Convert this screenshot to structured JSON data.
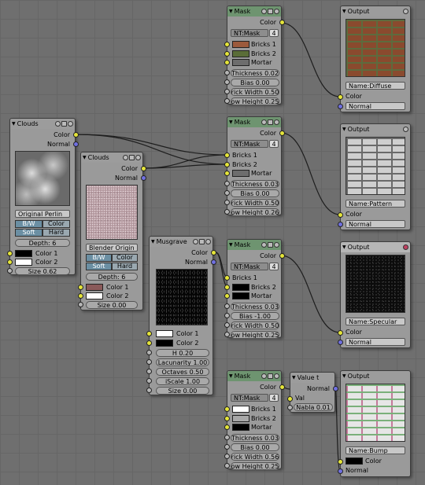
{
  "nodes": {
    "mask1": {
      "title": "Mask",
      "out_color": "Color",
      "nt": "NT:Mask",
      "num": "4",
      "bricks1": "Bricks 1",
      "bricks2": "Bricks 2",
      "mortar": "Mortar",
      "thickness": "Thickness 0.02",
      "bias": "Bias 0.00",
      "brick_width": "rick Width 0.50",
      "row_height": "ow Height 0.25",
      "sw1": "#9c5a3c",
      "sw2": "#5a6d38",
      "sw3": "#6d6d6d"
    },
    "mask2": {
      "title": "Mask",
      "out_color": "Color",
      "nt": "NT:Mask",
      "num": "4",
      "bricks1": "Bricks 1",
      "bricks2": "Bricks 2",
      "mortar": "Mortar",
      "thickness": "Thickness 0.03",
      "bias": "Bias 0.00",
      "brick_width": "rick Width 0.50",
      "row_height": "ow Height 0.26",
      "sw3": "#6d6d6d"
    },
    "mask3": {
      "title": "Mask",
      "out_color": "Color",
      "nt": "NT:Mask",
      "num": "4",
      "bricks1": "Bricks 1",
      "bricks2": "Bricks 2",
      "mortar": "Mortar",
      "thickness": "Thickness 0.03",
      "bias": "Bias -1.00",
      "brick_width": "rick Width 0.50",
      "row_height": "ow Height 0.25",
      "sw2": "#000000",
      "sw3": "#000000"
    },
    "mask4": {
      "title": "Mask",
      "out_color": "Color",
      "nt": "NT:Mask",
      "num": "4",
      "bricks1": "Bricks 1",
      "bricks2": "Bricks 2",
      "mortar": "Mortar",
      "thickness": "Thickness 0.03",
      "bias": "Bias 0.00",
      "brick_width": "rick Width 0.56",
      "row_height": "ow Height 0.25",
      "sw1": "#ffffff",
      "sw2": "#a8a8a8",
      "sw3": "#000000"
    },
    "out1": {
      "title": "Output",
      "name": "Name:Diffuse",
      "color": "Color",
      "normal": "Normal"
    },
    "out2": {
      "title": "Output",
      "name": "Name:Pattern",
      "color": "Color",
      "normal": "Normal"
    },
    "out3": {
      "title": "Output",
      "name": "Name:Specular",
      "color": "Color",
      "normal": "Normal"
    },
    "out4": {
      "title": "Output",
      "name": "Name:Bump",
      "color": "Color",
      "normal": "Normal"
    },
    "clouds1": {
      "title": "Clouds",
      "color": "Color",
      "normal": "Normal",
      "noise": "Original Perlin",
      "bw": "B/W",
      "col": "Color",
      "soft": "Soft",
      "hard": "Hard",
      "depth": "Depth: 6",
      "color1": "Color 1",
      "color2": "Color 2",
      "size": "Size 0.62"
    },
    "clouds2": {
      "title": "Clouds",
      "color": "Color",
      "normal": "Normal",
      "noise": "Blender Origin",
      "bw": "B/W",
      "col": "Color",
      "soft": "Soft",
      "hard": "Hard",
      "depth": "Depth: 6",
      "color1": "Color 1",
      "color2": "Color 2",
      "size": "Size 0.00"
    },
    "musgrave": {
      "title": "Musgrave",
      "color": "Color",
      "normal": "Normal",
      "color1": "Color 1",
      "color2": "Color 2",
      "h": "H 0.20",
      "lac": "Lacunarity 1.00",
      "oct": "Octaves 0.50",
      "iscale": "iScale 1.00",
      "size": "Size 0.00"
    },
    "value": {
      "title": "Value t",
      "normal": "Normal",
      "val": "Val",
      "nabla": "Nabla 0.01"
    }
  }
}
